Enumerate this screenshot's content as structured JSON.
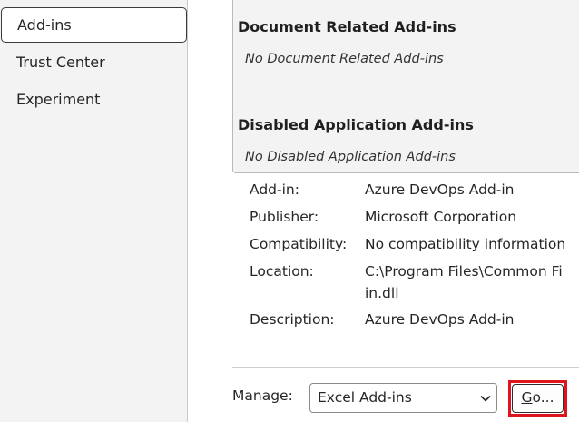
{
  "sidebar": {
    "items": [
      {
        "label": "Add-ins",
        "selected": true
      },
      {
        "label": "Trust Center",
        "selected": false
      },
      {
        "label": "Experiment",
        "selected": false
      }
    ]
  },
  "addins_list": {
    "document_related": {
      "heading": "Document Related Add-ins",
      "empty_text": "No Document Related Add-ins"
    },
    "disabled": {
      "heading": "Disabled Application Add-ins",
      "empty_text": "No Disabled Application Add-ins"
    }
  },
  "details": {
    "addin": {
      "label": "Add-in:",
      "value": "Azure DevOps Add-in"
    },
    "publisher": {
      "label": "Publisher:",
      "value": "Microsoft Corporation"
    },
    "compatibility": {
      "label": "Compatibility:",
      "value": "No compatibility information"
    },
    "location": {
      "label": "Location:",
      "value_line1": "C:\\Program Files\\Common Fi",
      "value_line2": "in.dll"
    },
    "description": {
      "label": "Description:",
      "value": "Azure DevOps Add-in"
    }
  },
  "manage": {
    "label": "Manage:",
    "selected": "Excel Add-ins",
    "go_mnemonic": "G",
    "go_rest": "o..."
  },
  "colors": {
    "highlight": "#e0141f",
    "sidebar_bg": "#f3f3f3"
  },
  "icons": {
    "dropdown": "chevron-down-icon"
  }
}
